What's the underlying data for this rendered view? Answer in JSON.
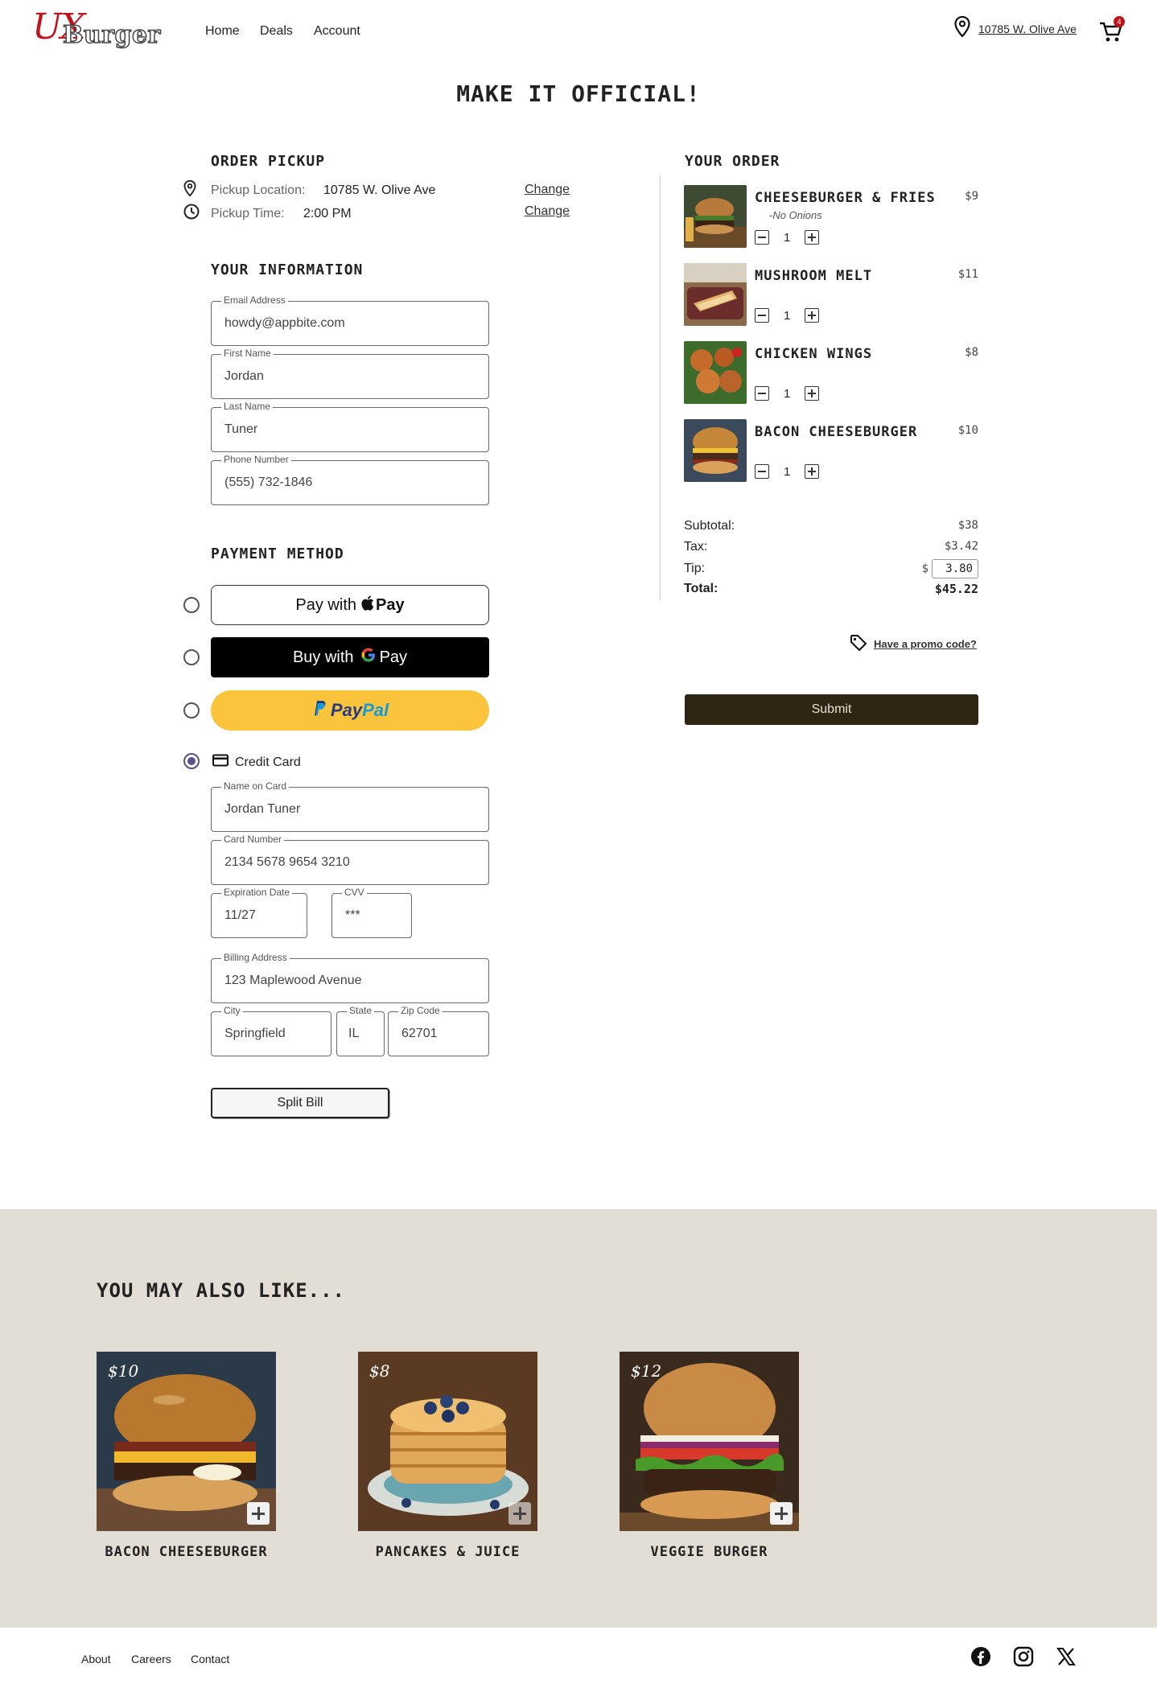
{
  "header": {
    "logo_ux": "UX",
    "logo_burger": "Burger",
    "nav": [
      "Home",
      "Deals",
      "Account"
    ],
    "location": "10785 W. Olive Ave",
    "cart_count": "4"
  },
  "page_title": "MAKE IT OFFICIAL!",
  "pickup": {
    "title": "ORDER PICKUP",
    "location_label": "Pickup Location:",
    "location_value": "10785 W. Olive Ave",
    "time_label": "Pickup Time:",
    "time_value": "2:00 PM",
    "change_label": "Change"
  },
  "info": {
    "title": "YOUR INFORMATION",
    "fields": [
      {
        "label": "Email Address",
        "value": "howdy@appbite.com"
      },
      {
        "label": "First Name",
        "value": "Jordan"
      },
      {
        "label": "Last Name",
        "value": "Tuner"
      },
      {
        "label": "Phone Number",
        "value": "(555) 732-1846"
      }
    ]
  },
  "payment": {
    "title": "PAYMENT METHOD",
    "apple_prefix": "Pay with",
    "apple_pay": "Pay",
    "google_prefix": "Buy with",
    "google_pay": "Pay",
    "paypal_pay": "Pay",
    "paypal_pal": "Pal",
    "credit_label": "Credit Card",
    "card_fields": {
      "name_label": "Name on Card",
      "name_value": "Jordan Tuner",
      "number_label": "Card Number",
      "number_value": "2134 5678 9654 3210",
      "exp_label": "Expiration Date",
      "exp_value": "11/27",
      "cvv_label": "CVV",
      "cvv_value": "***",
      "billing_label": "Billing Address",
      "billing_value": "123 Maplewood Avenue",
      "city_label": "City",
      "city_value": "Springfield",
      "state_label": "State",
      "state_value": "IL",
      "zip_label": "Zip Code",
      "zip_value": "62701"
    },
    "split_bill": "Split Bill"
  },
  "order": {
    "title": "YOUR ORDER",
    "items": [
      {
        "name": "CHEESEBURGER & FRIES",
        "note": "-No Onions",
        "price": "$9",
        "qty": "1"
      },
      {
        "name": "MUSHROOM MELT",
        "note": "",
        "price": "$11",
        "qty": "1"
      },
      {
        "name": "CHICKEN WINGS",
        "note": "",
        "price": "$8",
        "qty": "1"
      },
      {
        "name": "BACON CHEESEBURGER",
        "note": "",
        "price": "$10",
        "qty": "1"
      }
    ],
    "subtotal_label": "Subtotal:",
    "subtotal": "$38",
    "tax_label": "Tax:",
    "tax": "$3.42",
    "tip_label": "Tip:",
    "tip_currency": "$",
    "tip": "3.80",
    "total_label": "Total:",
    "total": "$45.22",
    "promo": "Have a promo code?",
    "submit": "Submit"
  },
  "suggestions": {
    "title": "YOU MAY ALSO LIKE...",
    "items": [
      {
        "name": "BACON CHEESEBURGER",
        "price": "$10"
      },
      {
        "name": "PANCAKES & JUICE",
        "price": "$8"
      },
      {
        "name": "VEGGIE BURGER",
        "price": "$12"
      }
    ]
  },
  "footer": {
    "links": [
      "About",
      "Careers",
      "Contact"
    ],
    "social_icons": [
      "facebook-icon",
      "instagram-icon",
      "x-icon"
    ]
  },
  "colors": {
    "brand_red": "#c0141b",
    "submit_bg": "#2e2513",
    "paypal_yellow": "#fcc43c",
    "suggest_bg": "#e2ddd5",
    "radio_selected": "#5a4f8f"
  }
}
